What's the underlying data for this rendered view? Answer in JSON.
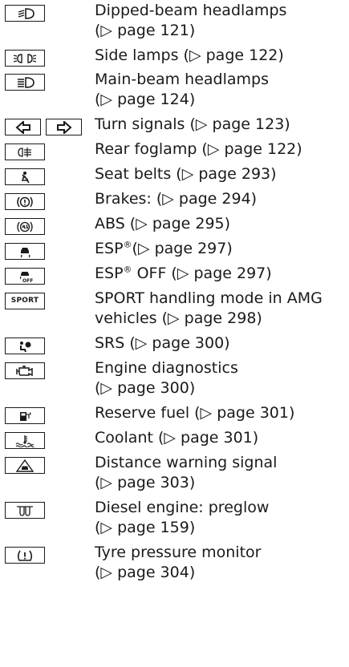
{
  "rows": [
    {
      "icon": "dipped-beam-icon",
      "lines": [
        "Dipped-beam headlamps",
        "(▷ page 121)"
      ]
    },
    {
      "icon": "side-lamps-icon",
      "lines": [
        "Side lamps (▷ page 122)"
      ]
    },
    {
      "icon": "main-beam-icon",
      "lines": [
        "Main-beam headlamps",
        "(▷ page 124)"
      ]
    },
    {
      "icon": "turn-signal-icons",
      "lines": [
        "Turn signals (▷ page 123)"
      ]
    },
    {
      "icon": "rear-foglamp-icon",
      "lines": [
        "Rear foglamp (▷ page 122)"
      ]
    },
    {
      "icon": "seat-belt-icon",
      "lines": [
        "Seat belts (▷ page 293)"
      ]
    },
    {
      "icon": "brake-icon",
      "lines": [
        "Brakes: (▷ page 294)"
      ]
    },
    {
      "icon": "abs-icon",
      "lines": [
        "ABS (▷ page 295)"
      ]
    },
    {
      "icon": "esp-icon",
      "lines_html": [
        "ESP<sup>®</sup>(▷ page 297)"
      ],
      "lines": [
        "ESP®(▷ page 297)"
      ]
    },
    {
      "icon": "esp-off-icon",
      "lines": [
        "ESP® OFF (▷ page 297)"
      ]
    },
    {
      "icon": "sport-icon",
      "icon_text": "SPORT",
      "lines": [
        "SPORT handling mode in AMG",
        "vehicles (▷ page 298)"
      ]
    },
    {
      "icon": "srs-icon",
      "lines": [
        "SRS (▷ page 300)"
      ]
    },
    {
      "icon": "engine-diagnostics-icon",
      "lines": [
        "Engine diagnostics",
        "(▷ page 300)"
      ]
    },
    {
      "icon": "reserve-fuel-icon",
      "lines": [
        "Reserve fuel (▷ page 301)"
      ]
    },
    {
      "icon": "coolant-icon",
      "lines": [
        "Coolant (▷ page 301)"
      ]
    },
    {
      "icon": "distance-warning-icon",
      "lines": [
        "Distance warning signal",
        "(▷ page 303)"
      ]
    },
    {
      "icon": "preglow-icon",
      "lines": [
        "Diesel engine: preglow",
        "(▷ page 159)"
      ]
    },
    {
      "icon": "tyre-pressure-icon",
      "lines": [
        "Tyre pressure monitor",
        "(▷ page 304)"
      ]
    }
  ]
}
